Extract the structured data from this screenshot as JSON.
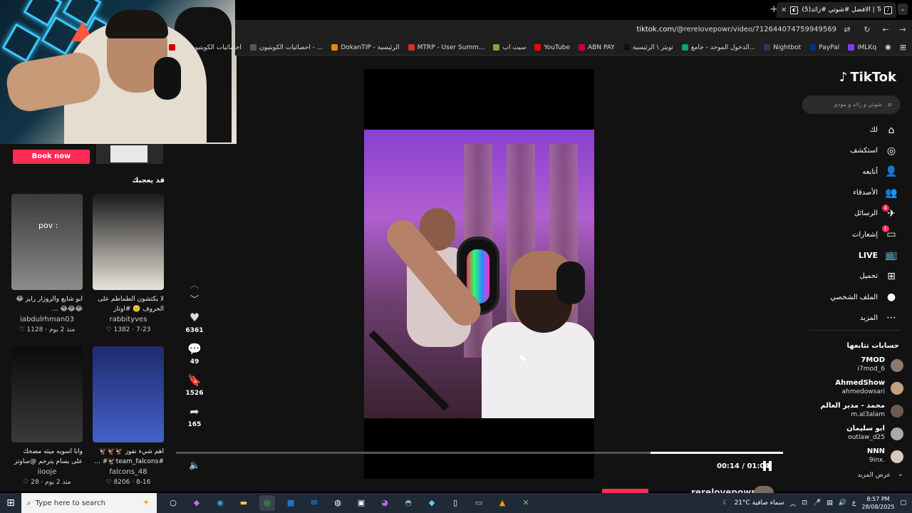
{
  "browser": {
    "tab_title": "(5)الأفضل #شوتي #زائد | Tok",
    "tab_favicon": "tiktok-icon",
    "url_host": "tiktok.com",
    "url_path": "/@rerelovepowr/video/7126440747599495​69",
    "bookmarks": [
      {
        "label": "M - احصائيات الكويتيون",
        "color": "#c00"
      },
      {
        "label": "احصائيات الكويتيون - ...",
        "color": "#555"
      },
      {
        "label": "DokanTIP - الرئيسية",
        "color": "#e58b00"
      },
      {
        "label": "MTRP - User Summ...",
        "color": "#c33"
      },
      {
        "label": "سيت اب",
        "color": "#7a4"
      },
      {
        "label": "YouTube",
        "color": "#ff0000"
      },
      {
        "label": "ABN PAY",
        "color": "#c03"
      },
      {
        "label": "تويتر \\ الرئيسية",
        "color": "#111"
      },
      {
        "label": "الدخول الموحد - جامع...",
        "color": "#0a6"
      },
      {
        "label": "Nightbot",
        "color": "#336"
      },
      {
        "label": "PayPal",
        "color": "#003087"
      },
      {
        "label": "iMLKq",
        "color": "#7b3fe4"
      }
    ]
  },
  "left": {
    "book_now": "Book now",
    "might_like": "قد يعجبك",
    "cards": [
      {
        "caption": "لا يكتشون الطماطم على الحروف 🙂 #اوتار #بيك...",
        "user": "rabbityves",
        "meta": "7-23 · 1382 ♡",
        "thumb_text": "",
        "colors": [
          "#1a1a1a",
          "#e8e3da"
        ]
      },
      {
        "caption": "ابو شايع والروزار رايز 😂😂😂😂 ...",
        "user": "iabdulrhman03",
        "meta": "منذ 2 يوم · 1128 ♡",
        "thumb_text": "pov :",
        "colors": [
          "#3a3a3a",
          "#8b8b88"
        ]
      },
      {
        "caption": "اهم شيء نفوز 🦅🦅🦅 #team_falcons🦅# ...",
        "user": "falcons_48",
        "meta": "8-16 · 8206 ♡",
        "thumb_text": "",
        "colors": [
          "#1f2a6d",
          "#4361c9"
        ]
      },
      {
        "caption": "وانا اسويه ميثه مضحك على يسام يترحم @ساوتر | سليما...",
        "user": "iiooje",
        "meta": "منذ 2 يوم · 28 ♡",
        "thumb_text": "",
        "colors": [
          "#0b0b0b",
          "#3a3a3a"
        ]
      }
    ]
  },
  "video": {
    "likes": "6361",
    "comments": "49",
    "saves": "1526",
    "shares": "165",
    "time": "00:14 / 01:04",
    "progress": 0.2187,
    "author": "rerelovepowr"
  },
  "right": {
    "logo": "TikTok",
    "search_placeholder": "شوتي و زائد و مودي",
    "nav": [
      {
        "label": "لك",
        "icon": "home-icon",
        "glyph": "⌂",
        "badge": ""
      },
      {
        "label": "استكشف",
        "icon": "compass-icon",
        "glyph": "◎",
        "badge": ""
      },
      {
        "label": "أتابعه",
        "icon": "follow-icon",
        "glyph": "👤",
        "badge": ""
      },
      {
        "label": "الأصدقاء",
        "icon": "friends-icon",
        "glyph": "👥",
        "badge": ""
      },
      {
        "label": "الرسائل",
        "icon": "messages-icon",
        "glyph": "✈",
        "badge": "4"
      },
      {
        "label": "إشعارات",
        "icon": "inbox-icon",
        "glyph": "▭",
        "badge": "1"
      },
      {
        "label": "LIVE",
        "icon": "live-icon",
        "glyph": "📺",
        "badge": ""
      },
      {
        "label": "تحميل",
        "icon": "upload-icon",
        "glyph": "⊞",
        "badge": ""
      },
      {
        "label": "الملف الشخصي",
        "icon": "profile-icon",
        "glyph": "●",
        "badge": ""
      },
      {
        "label": "المزيد",
        "icon": "more-icon",
        "glyph": "⋯",
        "badge": ""
      }
    ],
    "following_title": "حسابات تتابعها",
    "following": [
      {
        "name": "7MOD",
        "handle": "i7mod_6",
        "color": "#8a7a70"
      },
      {
        "name": "AhmedShow",
        "handle": "ahmedowsari",
        "color": "#c3a080"
      },
      {
        "name": "محمد - مدير العالم",
        "handle": "m.al3alam",
        "color": "#6d5b52"
      },
      {
        "name": "ابو سليمان",
        "handle": "outlaw_d25",
        "color": "#a9a9b0"
      },
      {
        "name": "NNN",
        "handle": "9inx.",
        "color": "#d8c8b8"
      }
    ],
    "see_more": "عرض المزيد"
  },
  "taskbar": {
    "search_placeholder": "Type here to search",
    "weather": "21°C  سماء صافية",
    "lang": "ع",
    "time": "8:57 PM",
    "date": "28/08/2025"
  }
}
